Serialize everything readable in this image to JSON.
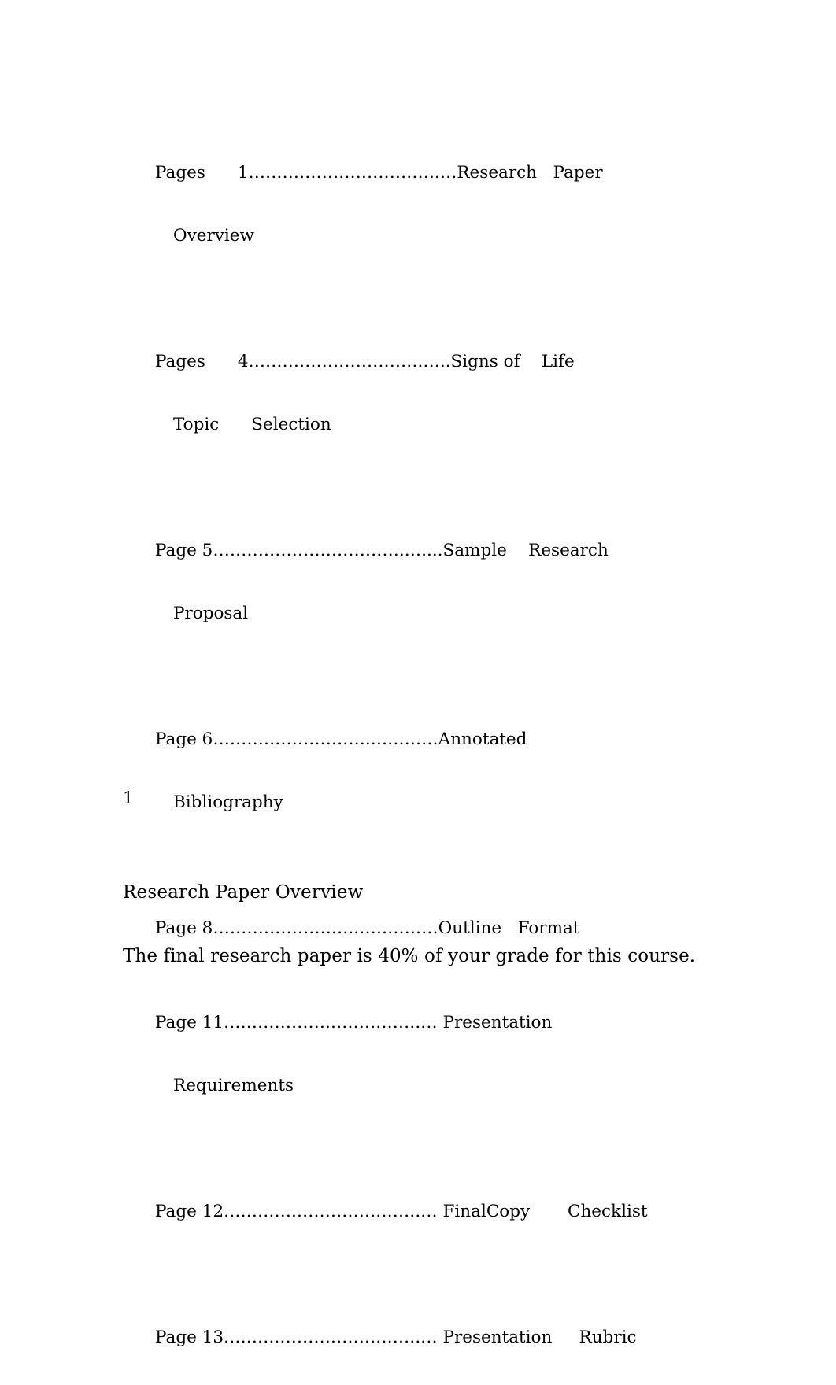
{
  "document": {
    "page_number": "1",
    "background_color": "#ffffff",
    "text_color": "#000000"
  },
  "toc": {
    "entries": [
      {
        "line1": "Pages      1…………………………….…Research   Paper",
        "line2": "Overview"
      },
      {
        "line1": "Pages      4………………………….…..Signs of    Life",
        "line2": "Topic      Selection"
      },
      {
        "line1": "Page 5…………………………….…....Sample    Research",
        "line2": "Proposal"
      },
      {
        "line1": "Page 6……………………….…………Annotated",
        "line2": "Bibliography"
      },
      {
        "line1": "Page 8…………………….……………Outline   Format",
        "line2": ""
      },
      {
        "line1": "Page 11……………….…………….… Presentation",
        "line2": "Requirements"
      },
      {
        "line1": "Page 12………….………………….… FinalCopy       Checklist",
        "line2": ""
      },
      {
        "line1": "",
        "line2": ""
      },
      {
        "line1": "Page 13……….…………………….… Presentation     Rubric",
        "line2": ""
      }
    ]
  },
  "section": {
    "heading": "Research Paper Overview",
    "paragraph": "The final research paper is 40% of your grade for this course."
  }
}
